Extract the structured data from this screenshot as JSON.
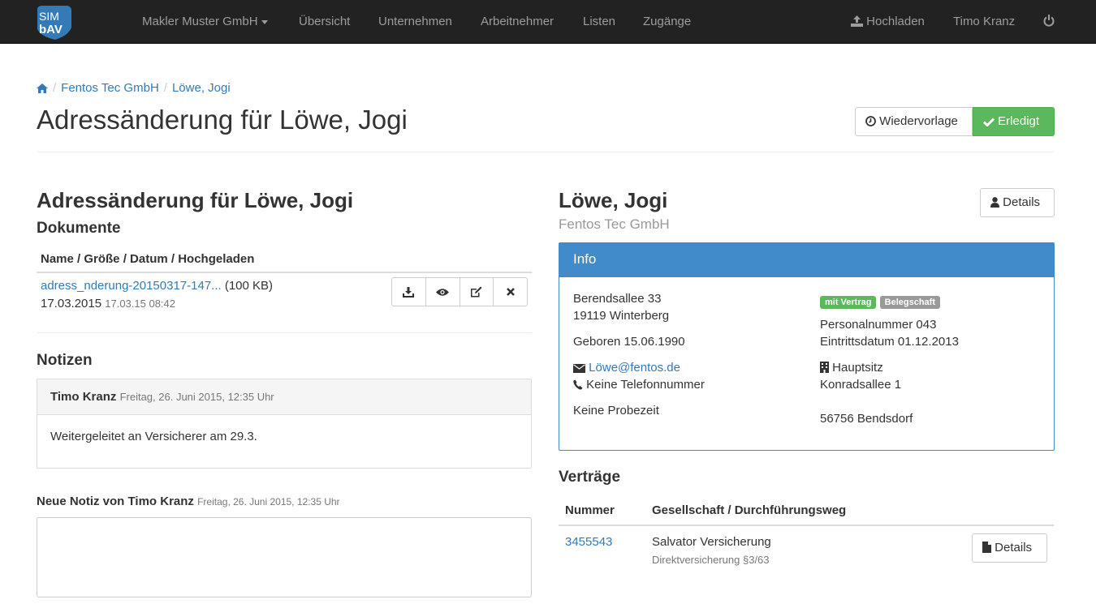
{
  "navbar": {
    "logo_text_top": "SIM",
    "logo_text_bottom": "bAV",
    "items": [
      {
        "label": "Makler Muster GmbH"
      },
      {
        "label": "Übersicht"
      },
      {
        "label": "Unternehmen"
      },
      {
        "label": "Arbeitnehmer"
      },
      {
        "label": "Listen"
      },
      {
        "label": "Zugänge"
      }
    ],
    "upload_label": "Hochladen",
    "user_label": "Timo Kranz",
    "power_icon": "power-icon"
  },
  "breadcrumb": {
    "home_icon": "home-icon",
    "company": "Fentos Tec GmbH",
    "employee": "Löwe, Jogi"
  },
  "page": {
    "title": "Adressänderung für Löwe, Jogi",
    "resubmit_label": "Wiedervorlage",
    "done_label": "Erledigt"
  },
  "task": {
    "title": "Adressänderung für Löwe, Jogi",
    "documents_title": "Dokumente",
    "documents_header": "Name / Größe / Datum / Hochgeladen",
    "documents": [
      {
        "name": "adress_nderung-20150317-147...",
        "size": "(100 KB)",
        "date": "17.03.2015",
        "uploaded": "17.03.15 08:42"
      }
    ],
    "doc_actions": [
      "download-icon",
      "eye-icon",
      "edit-icon",
      "delete-icon"
    ]
  },
  "notes": {
    "title": "Notizen",
    "items": [
      {
        "author": "Timo Kranz",
        "timestamp": "Freitag, 26. Juni 2015, 12:35 Uhr",
        "text": "Weitergeleitet an Versicherer am 29.3."
      }
    ],
    "new_note_label": "Neue Notiz von Timo Kranz",
    "new_note_timestamp": "Freitag, 26. Juni 2015, 12:35 Uhr",
    "new_note_value": ""
  },
  "employee": {
    "name": "Löwe, Jogi",
    "company": "Fentos Tec GmbH",
    "details_label": "Details",
    "info_title": "Info",
    "street": "Berendsallee 33",
    "city": "19119 Winterberg",
    "born": "Geboren 15.06.1990",
    "email": "Löwe@fentos.de",
    "phone": "Keine Telefonnummer",
    "probation": "Keine Probezeit",
    "badges": [
      {
        "label": "mit Vertrag",
        "color": "#5cb85c"
      },
      {
        "label": "Belegschaft",
        "color": "#999999"
      }
    ],
    "personnel_number": "Personalnummer 043",
    "entry_date": "Eintrittsdatum 01.12.2013",
    "site_name": "Hauptsitz",
    "site_street": "Konradsallee 1",
    "site_city": "56756 Bendsdorf"
  },
  "contracts": {
    "title": "Verträge",
    "headers": [
      "Nummer",
      "Gesellschaft / Durchführungsweg"
    ],
    "rows": [
      {
        "number": "3455543",
        "company": "Salvator Versicherung",
        "type": "Direktversicherung §3/63",
        "details_label": "Details"
      }
    ]
  },
  "colors": {
    "navbar_bg": "#222222",
    "link": "#337ab7",
    "success": "#5cb85c",
    "primary": "#428bca"
  }
}
